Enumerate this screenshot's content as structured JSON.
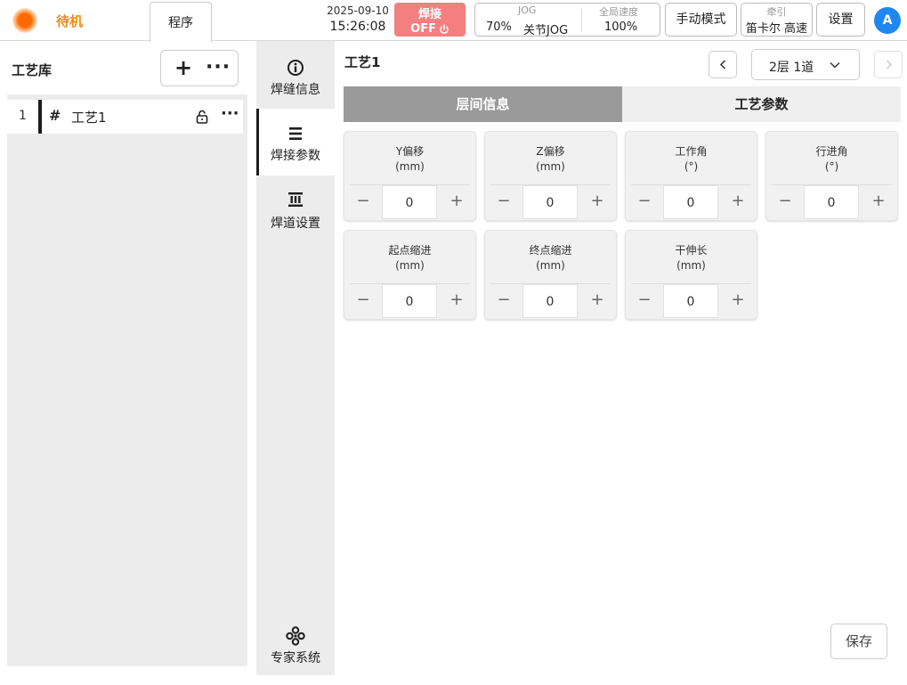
{
  "header": {
    "status": "待机",
    "status_color": "#f08a1c",
    "program_tab": "程序",
    "date": "2025-09-10",
    "time": "15:26:08",
    "weld": {
      "label": "焊接",
      "state": "OFF",
      "bg": "#f47f7f"
    },
    "jog": {
      "label": "JOG",
      "percent": "70%",
      "mode": "关节JOG"
    },
    "global_speed": {
      "label": "全局速度",
      "value": "100%"
    },
    "manual_mode": "手动模式",
    "traction": {
      "label": "牵引",
      "value": "笛卡尔 高速"
    },
    "settings": "设置",
    "avatar_letter": "A"
  },
  "library": {
    "title": "工艺库",
    "items": [
      {
        "index": "1",
        "hash": "#",
        "name": "工艺1"
      }
    ]
  },
  "sidenav": [
    {
      "label": "焊缝信息",
      "icon": "info-icon"
    },
    {
      "label": "焊接参数",
      "icon": "list-icon",
      "active": true
    },
    {
      "label": "焊道设置",
      "icon": "weld-pass-icon"
    },
    {
      "label": "专家系统",
      "icon": "expert-system-icon"
    }
  ],
  "main": {
    "title": "工艺1",
    "layer_select": "2层  1道",
    "tabs": [
      "层间信息",
      "工艺参数"
    ],
    "active_tab": "层间信息",
    "params": [
      {
        "name": "Y偏移",
        "unit": "(mm)",
        "value": "0"
      },
      {
        "name": "Z偏移",
        "unit": "(mm)",
        "value": "0"
      },
      {
        "name": "工作角",
        "unit": "(°)",
        "value": "0"
      },
      {
        "name": "行进角",
        "unit": "(°)",
        "value": "0"
      },
      {
        "name": "起点缩进",
        "unit": "(mm)",
        "value": "0"
      },
      {
        "name": "终点缩进",
        "unit": "(mm)",
        "value": "0"
      },
      {
        "name": "干伸长",
        "unit": "(mm)",
        "value": "0"
      }
    ],
    "stepper_minus": "−",
    "stepper_plus": "+",
    "save": "保存"
  }
}
